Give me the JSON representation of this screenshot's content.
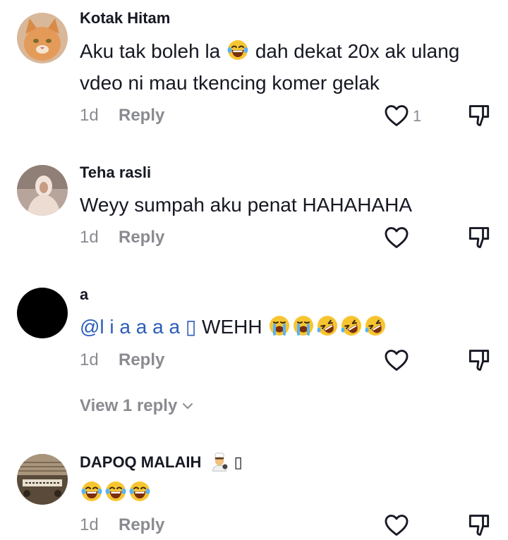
{
  "comments": [
    {
      "username": "Kotak Hitam",
      "text_before": "Aku tak boleh la",
      "text_after": "dah dekat 20x ak ulang vdeo ni mau tkencing komer gelak",
      "emoji": "tears-of-joy",
      "time": "1d",
      "reply_label": "Reply",
      "likes": "1",
      "avatar": "orange-cat"
    },
    {
      "username": "Teha rasli",
      "text": "Weyy sumpah aku penat HAHAHAHA",
      "time": "1d",
      "reply_label": "Reply",
      "avatar": "woman-photo"
    },
    {
      "username": "a",
      "mention": "@l i a a a a",
      "mention_suffix": "▯",
      "text": "WEHH",
      "emojis": [
        "loudly-crying",
        "loudly-crying",
        "rolling-laughing",
        "rolling-laughing",
        "rolling-laughing"
      ],
      "time": "1d",
      "reply_label": "Reply",
      "view_replies": "View 1 reply",
      "avatar": "black-circle"
    },
    {
      "username": "DAPOQ MALAIH",
      "username_suffix": "▯",
      "username_emoji": "cook",
      "emojis": [
        "tears-of-joy",
        "tears-of-joy",
        "tears-of-joy"
      ],
      "time": "1d",
      "reply_label": "Reply",
      "avatar": "radio-photo"
    }
  ],
  "colors": {
    "text": "#161823",
    "muted": "#8a8b91",
    "mention": "#2b5db9"
  }
}
